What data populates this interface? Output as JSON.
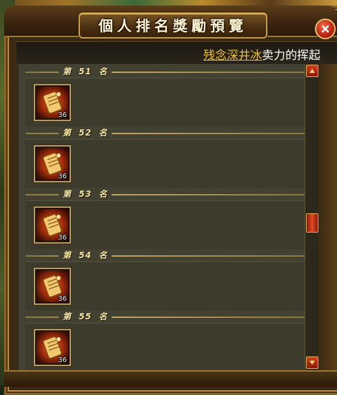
{
  "dialog": {
    "title": "個人排名獎勵預覽",
    "close_icon": "close-icon"
  },
  "notice": {
    "player_name": "残念深井冰",
    "message": "卖力的挥起"
  },
  "ranks": [
    {
      "label": "第  51  名",
      "item": {
        "icon": "scroll-icon",
        "count": "36"
      }
    },
    {
      "label": "第  52  名",
      "item": {
        "icon": "scroll-icon",
        "count": "36"
      }
    },
    {
      "label": "第  53  名",
      "item": {
        "icon": "scroll-icon",
        "count": "36"
      }
    },
    {
      "label": "第  54  名",
      "item": {
        "icon": "scroll-icon",
        "count": "36"
      }
    },
    {
      "label": "第  55  名",
      "item": {
        "icon": "scroll-icon",
        "count": "36"
      }
    }
  ],
  "scrollbar": {
    "up_icon": "arrow-up-icon",
    "down_icon": "arrow-down-icon",
    "position_fraction": 0.55
  },
  "colors": {
    "accent_gold": "#c9a050",
    "close_red": "#c02a14",
    "player_name_yellow": "#f0c030"
  }
}
